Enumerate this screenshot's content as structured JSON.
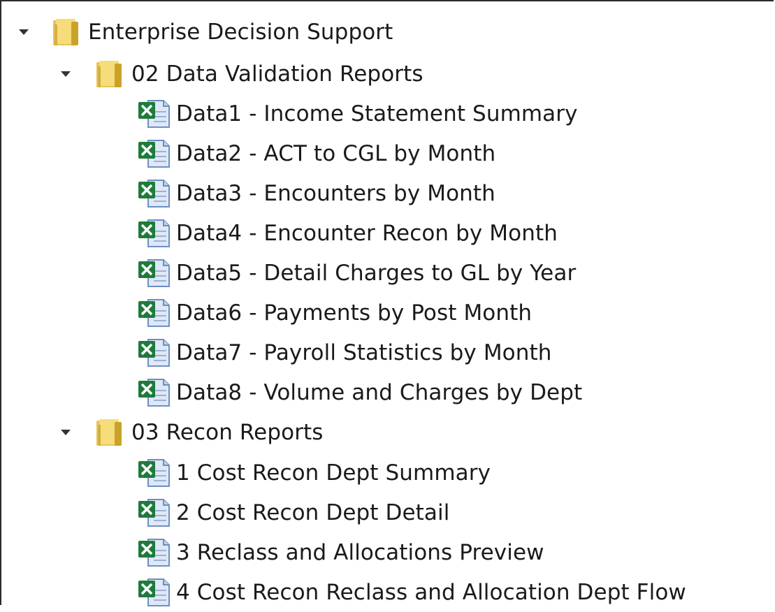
{
  "tree": {
    "root": {
      "label": "Enterprise Decision Support",
      "icon": "folder-icon",
      "expanded": true
    },
    "folders": [
      {
        "label": "02 Data Validation Reports",
        "icon": "folder-icon",
        "expanded": true,
        "items": [
          {
            "label": "Data1 - Income Statement Summary",
            "icon": "excel-file-icon"
          },
          {
            "label": "Data2 - ACT to CGL by Month",
            "icon": "excel-file-icon"
          },
          {
            "label": "Data3 - Encounters by Month",
            "icon": "excel-file-icon"
          },
          {
            "label": "Data4 - Encounter Recon by Month",
            "icon": "excel-file-icon"
          },
          {
            "label": "Data5 - Detail Charges to GL by Year",
            "icon": "excel-file-icon"
          },
          {
            "label": "Data6 - Payments by Post Month",
            "icon": "excel-file-icon"
          },
          {
            "label": "Data7 - Payroll Statistics by Month",
            "icon": "excel-file-icon"
          },
          {
            "label": "Data8 - Volume and Charges by Dept",
            "icon": "excel-file-icon"
          }
        ]
      },
      {
        "label": "03 Recon Reports",
        "icon": "folder-icon",
        "expanded": true,
        "items": [
          {
            "label": "1 Cost Recon Dept Summary",
            "icon": "excel-file-icon"
          },
          {
            "label": "2 Cost Recon Dept Detail",
            "icon": "excel-file-icon"
          },
          {
            "label": "3 Reclass and Allocations Preview",
            "icon": "excel-file-icon"
          },
          {
            "label": "4 Cost Recon Reclass and Allocation Dept Flow",
            "icon": "excel-file-icon"
          }
        ]
      }
    ]
  },
  "colors": {
    "folder_light": "#f6dc7a",
    "folder_dark": "#c9a227",
    "excel_green": "#1e7b3a",
    "doc_blue": "#6d8fc4",
    "expander": "#333333"
  }
}
